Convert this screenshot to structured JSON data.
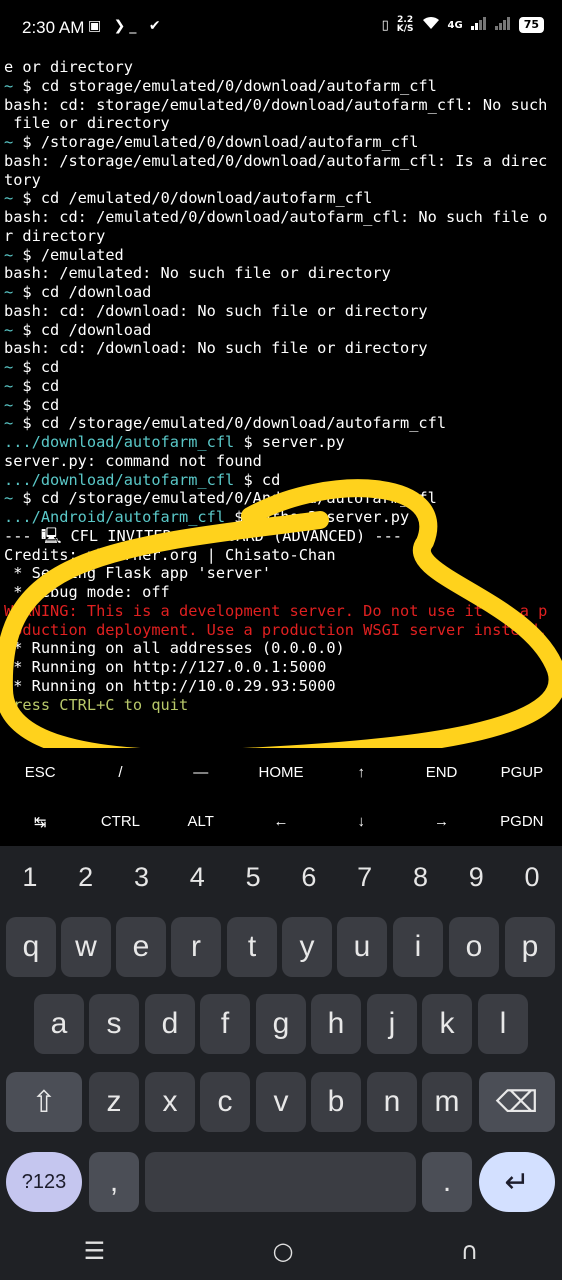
{
  "status_bar": {
    "time": "2:30 AM",
    "left_icons": "▣ ❯_ ✔",
    "net_speed_value": "2.2",
    "net_speed_unit": "K/S",
    "network": "4G",
    "battery": "75"
  },
  "terminal": {
    "lines": [
      [
        {
          "t": "e or directory"
        }
      ],
      [
        {
          "t": "~",
          "c": "tilde"
        },
        {
          "t": " $ cd storage/emulated/0/download/autofarm_cfl"
        }
      ],
      [
        {
          "t": "bash: cd: storage/emulated/0/download/autofarm_cfl: No such"
        }
      ],
      [
        {
          "t": " file or directory"
        }
      ],
      [
        {
          "t": "~",
          "c": "tilde"
        },
        {
          "t": " $ /storage/emulated/0/download/autofarm_cfl"
        }
      ],
      [
        {
          "t": "bash: /storage/emulated/0/download/autofarm_cfl: Is a direc"
        }
      ],
      [
        {
          "t": "tory"
        }
      ],
      [
        {
          "t": "~",
          "c": "tilde"
        },
        {
          "t": " $ cd /emulated/0/download/autofarm_cfl"
        }
      ],
      [
        {
          "t": "bash: cd: /emulated/0/download/autofarm_cfl: No such file o"
        }
      ],
      [
        {
          "t": "r directory"
        }
      ],
      [
        {
          "t": "~",
          "c": "tilde"
        },
        {
          "t": " $ /emulated"
        }
      ],
      [
        {
          "t": "bash: /emulated: No such file or directory"
        }
      ],
      [
        {
          "t": "~",
          "c": "tilde"
        },
        {
          "t": " $ cd /download"
        }
      ],
      [
        {
          "t": "bash: cd: /download: No such file or directory"
        }
      ],
      [
        {
          "t": "~",
          "c": "tilde"
        },
        {
          "t": " $ cd /download"
        }
      ],
      [
        {
          "t": "bash: cd: /download: No such file or directory"
        }
      ],
      [
        {
          "t": "~",
          "c": "tilde"
        },
        {
          "t": " $ cd"
        }
      ],
      [
        {
          "t": "~",
          "c": "tilde"
        },
        {
          "t": " $ cd"
        }
      ],
      [
        {
          "t": "~",
          "c": "tilde"
        },
        {
          "t": " $ cd"
        }
      ],
      [
        {
          "t": "~",
          "c": "tilde"
        },
        {
          "t": " $ cd /storage/emulated/0/download/autofarm_cfl"
        }
      ],
      [
        {
          "t": ".../download/autofarm_cfl",
          "c": "path"
        },
        {
          "t": " $ server.py"
        }
      ],
      [
        {
          "t": "server.py: command not found"
        }
      ],
      [
        {
          "t": ".../download/autofarm_cfl",
          "c": "path"
        },
        {
          "t": " $ cd"
        }
      ],
      [
        {
          "t": "~",
          "c": "tilde"
        },
        {
          "t": " $ cd /storage/emulated/0/Android/autofarm_cfl"
        }
      ],
      [
        {
          "t": ".../Android/autofarm_cfl",
          "c": "path"
        },
        {
          "t": " $ python3 server.py"
        }
      ],
      [
        {
          "t": "--- 🖳 CFL INVITER DASHBOARD (ADVANCED) ---"
        }
      ],
      [
        {
          "t": "Credits: phcorner.org | Chisato-Chan"
        }
      ],
      [
        {
          "t": " * Serving Flask app 'server'"
        }
      ],
      [
        {
          "t": " * Debug mode: off"
        }
      ],
      [
        {
          "t": "WARNING: This is a development server. Do not use it in a p",
          "c": "red"
        }
      ],
      [
        {
          "t": "roduction deployment. Use a production WSGI server instead.",
          "c": "red"
        }
      ],
      [
        {
          "t": " * Running on all addresses (0.0.0.0)"
        }
      ],
      [
        {
          "t": " * Running on http://127.0.0.1:5000"
        }
      ],
      [
        {
          "t": " * Running on http://10.0.29.93:5000"
        }
      ],
      [
        {
          "t": "Press CTRL+C to quit",
          "c": "green"
        }
      ]
    ]
  },
  "extra_keys": {
    "row1": [
      "ESC",
      "/",
      "—",
      "HOME",
      "↑",
      "END",
      "PGUP"
    ],
    "row2": [
      "↹",
      "CTRL",
      "ALT",
      "←",
      "↓",
      "→",
      "PGDN"
    ]
  },
  "keyboard": {
    "numbers": [
      "1",
      "2",
      "3",
      "4",
      "5",
      "6",
      "7",
      "8",
      "9",
      "0"
    ],
    "row1": [
      "q",
      "w",
      "e",
      "r",
      "t",
      "y",
      "u",
      "i",
      "o",
      "p"
    ],
    "row2": [
      "a",
      "s",
      "d",
      "f",
      "g",
      "h",
      "j",
      "k",
      "l"
    ],
    "row3": [
      "z",
      "x",
      "c",
      "v",
      "b",
      "n",
      "m"
    ],
    "shift": "⇧",
    "backspace": "⌫",
    "symbols": "?123",
    "comma": ",",
    "period": ".",
    "enter": "↵"
  },
  "navbar": {
    "recents": "☰",
    "home": "○",
    "back": "∩"
  },
  "colors": {
    "accent_yellow": "#ffd21c",
    "prompt_cyan": "#5ac8c8",
    "warning_red": "#e02020",
    "quit_green": "#b8c86a"
  }
}
